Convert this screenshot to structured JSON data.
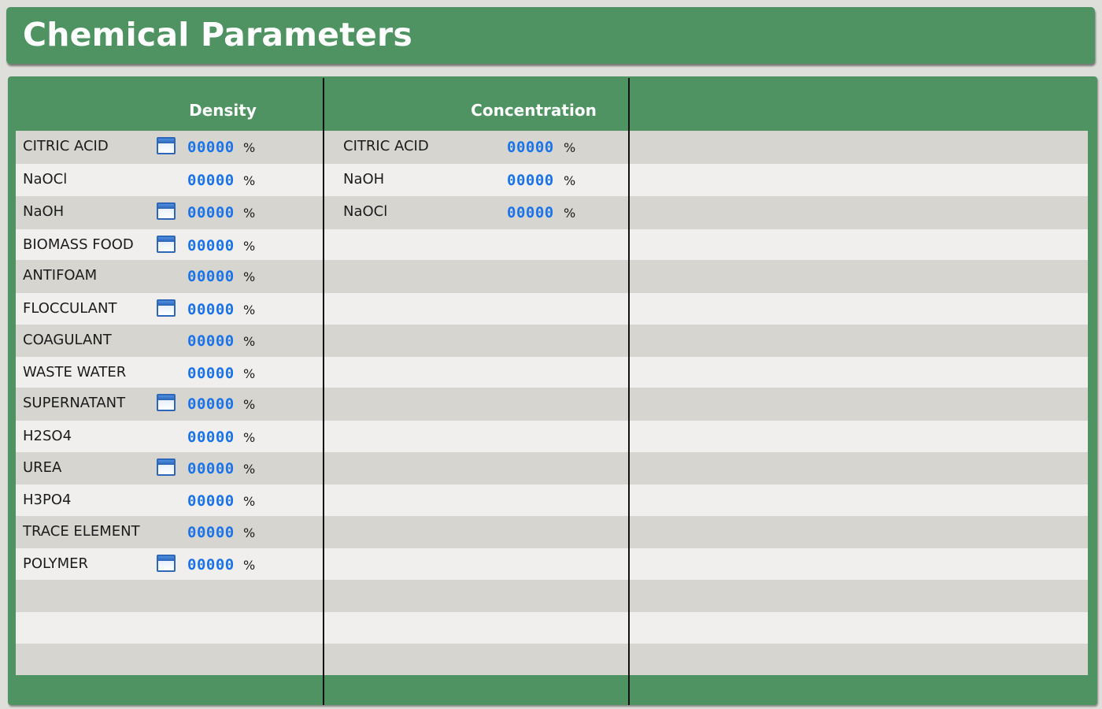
{
  "title": "Chemical Parameters",
  "columns": {
    "density": "Density",
    "concentration": "Concentration"
  },
  "density": [
    {
      "label": "CITRIC ACID",
      "value": "00000",
      "unit": "%",
      "icon": true
    },
    {
      "label": "NaOCl",
      "value": "00000",
      "unit": "%",
      "icon": false
    },
    {
      "label": "NaOH",
      "value": "00000",
      "unit": "%",
      "icon": true
    },
    {
      "label": "BIOMASS FOOD",
      "value": "00000",
      "unit": "%",
      "icon": true
    },
    {
      "label": "ANTIFOAM",
      "value": "00000",
      "unit": "%",
      "icon": false
    },
    {
      "label": "FLOCCULANT",
      "value": "00000",
      "unit": "%",
      "icon": true
    },
    {
      "label": "COAGULANT",
      "value": "00000",
      "unit": "%",
      "icon": false
    },
    {
      "label": "WASTE WATER",
      "value": "00000",
      "unit": "%",
      "icon": false
    },
    {
      "label": "SUPERNATANT",
      "value": "00000",
      "unit": "%",
      "icon": true
    },
    {
      "label": "H2SO4",
      "value": "00000",
      "unit": "%",
      "icon": false
    },
    {
      "label": "UREA",
      "value": "00000",
      "unit": "%",
      "icon": true
    },
    {
      "label": "H3PO4",
      "value": "00000",
      "unit": "%",
      "icon": false
    },
    {
      "label": "TRACE ELEMENT",
      "value": "00000",
      "unit": "%",
      "icon": false
    },
    {
      "label": "POLYMER",
      "value": "00000",
      "unit": "%",
      "icon": true
    }
  ],
  "concentration": [
    {
      "label": "CITRIC ACID",
      "value": "00000",
      "unit": "%"
    },
    {
      "label": "NaOH",
      "value": "00000",
      "unit": "%"
    },
    {
      "label": "NaOCl",
      "value": "00000",
      "unit": "%"
    }
  ],
  "colors": {
    "header_green": "#4f9362",
    "row_dark": "#d6d5d0",
    "row_light": "#f0efee",
    "value_blue": "#1a73e8"
  },
  "icons": {
    "detail_window": "window-icon"
  }
}
